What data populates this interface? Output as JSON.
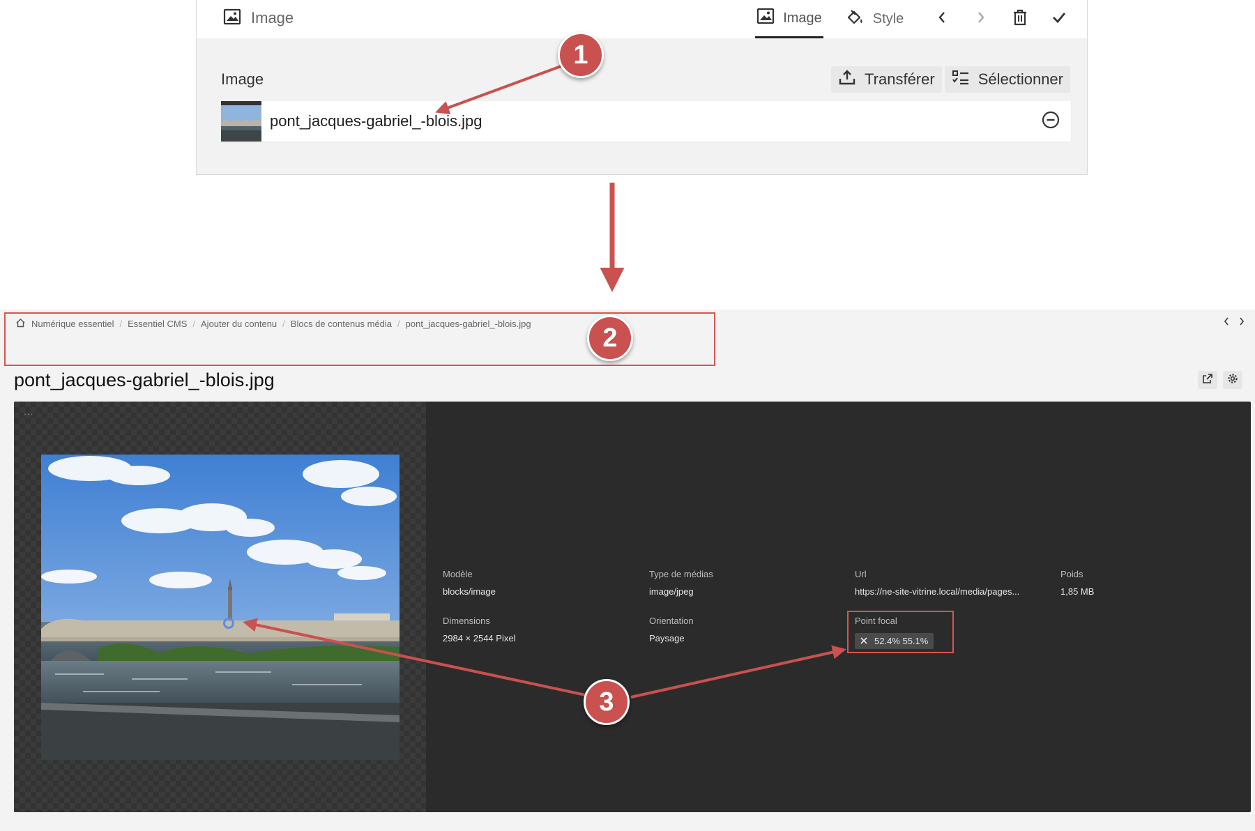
{
  "editor": {
    "block_type_label": "Image",
    "tabs": [
      {
        "label": "Image",
        "active": true
      },
      {
        "label": "Style",
        "active": false
      }
    ],
    "field_label": "Image",
    "upload_label": "Transférer",
    "select_label": "Sélectionner",
    "file_name": "pont_jacques-gabriel_-blois.jpg"
  },
  "media": {
    "breadcrumb": [
      "Numérique essentiel",
      "Essentiel CMS",
      "Ajouter du contenu",
      "Blocs de contenus média",
      "pont_jacques-gabriel_-blois.jpg"
    ],
    "title": "pont_jacques-gabriel_-blois.jpg",
    "dots": "...",
    "meta": {
      "model_label": "Modèle",
      "model_value": "blocks/image",
      "type_label": "Type de médias",
      "type_value": "image/jpeg",
      "url_label": "Url",
      "url_value": "https://ne-site-vitrine.local/media/pages...",
      "weight_label": "Poids",
      "weight_value": "1,85 MB",
      "dimensions_label": "Dimensions",
      "dimensions_value": "2984 × 2544 Pixel",
      "orientation_label": "Orientation",
      "orientation_value": "Paysage",
      "focal_label": "Point focal",
      "focal_value": "52.4% 55.1%"
    }
  },
  "annotations": {
    "marker1": "1",
    "marker2": "2",
    "marker3": "3",
    "color": "#c9514f"
  }
}
